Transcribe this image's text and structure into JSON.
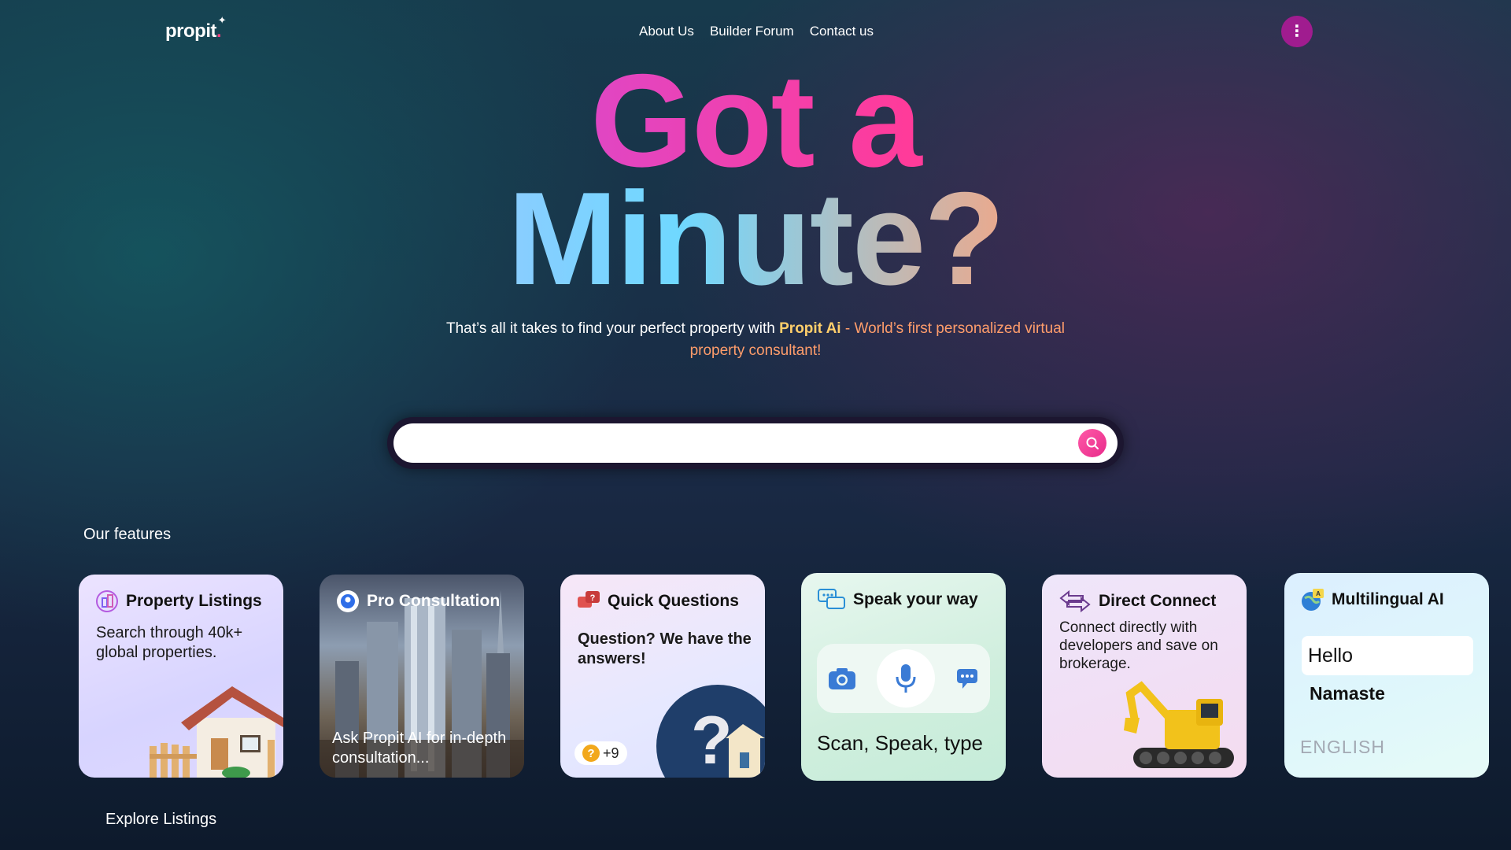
{
  "header": {
    "logo_text": "propit",
    "nav": [
      "About Us",
      "Builder Forum",
      "Contact us"
    ],
    "menu_icon": "kebab-menu-icon",
    "menu_color": "#a01c8f"
  },
  "hero": {
    "line1": "Got a",
    "line2": "Minute?",
    "sub_text": "That’s all it takes to find your perfect property with",
    "brand": "Propit Ai",
    "tagline": "- World’s first personalized virtual property consultant!"
  },
  "search": {
    "placeholder": "",
    "button_icon": "search-icon"
  },
  "features_title": "Our features",
  "features": [
    {
      "title": "Property Listings",
      "desc": "Search through 40k+ global properties.",
      "icon": "building-icon"
    },
    {
      "title": "Pro Consultation",
      "desc": "Ask Propit AI for in-depth consultation...",
      "icon": "consultant-icon"
    },
    {
      "title": "Quick Questions",
      "desc": "Question? We have the answers!",
      "badge": "+9",
      "icon": "question-chat-icon"
    },
    {
      "title": "Speak your way",
      "desc": "Scan, Speak, type",
      "icon": "chat-bubbles-icon"
    },
    {
      "title": "Direct Connect",
      "desc": "Connect directly with developers and save on brokerage.",
      "icon": "arrows-connect-icon"
    },
    {
      "title": "Multilingual AI",
      "greeting": "Hello",
      "alt": "Namaste",
      "lang": "ENGLISH",
      "icon": "globe-translate-icon"
    }
  ],
  "explore_title": "Explore Listings",
  "colors": {
    "accent": "#e82a8a",
    "brand": "#ffcf6b",
    "tagline": "#ff9d6b"
  }
}
